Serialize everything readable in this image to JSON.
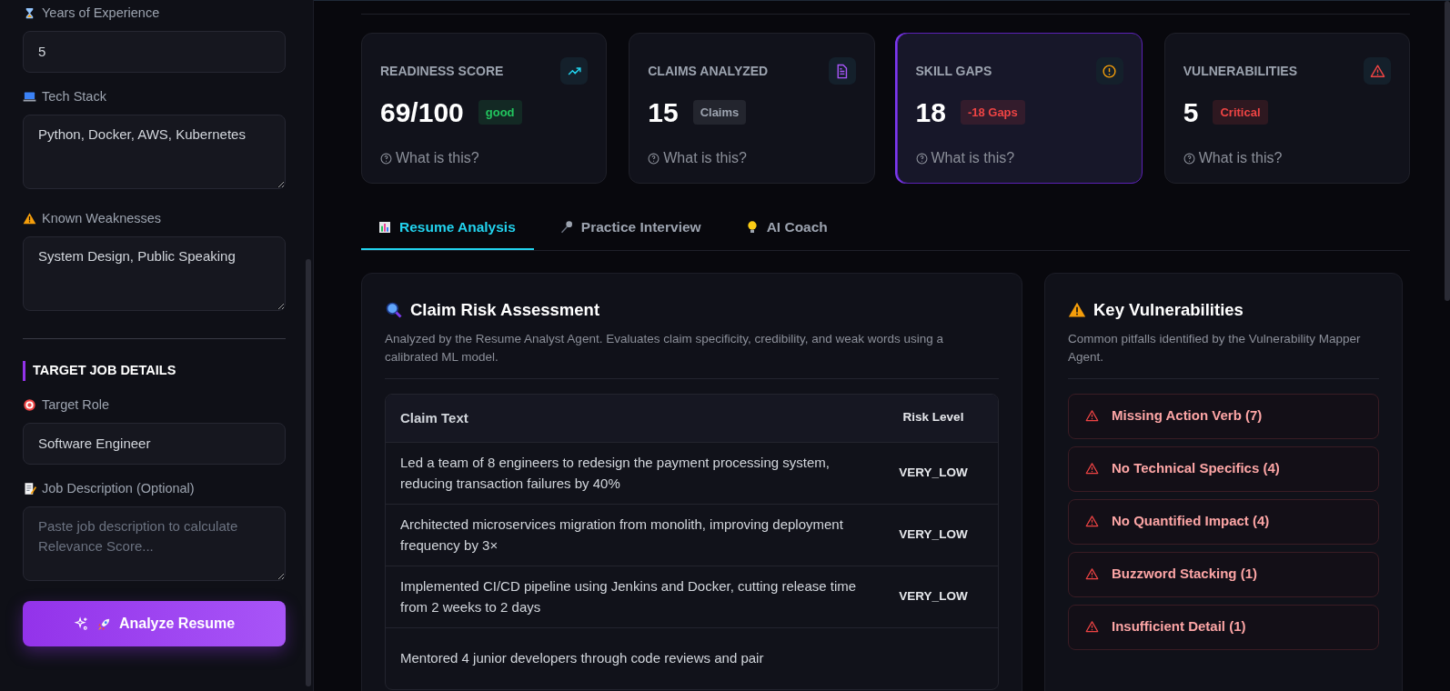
{
  "sidebar": {
    "fields_top": [
      {
        "label": "Years of Experience",
        "kind": "input",
        "value": "5"
      },
      {
        "label": "Tech Stack",
        "kind": "textarea",
        "value": "Python, Docker, AWS, Kubernetes"
      },
      {
        "label": "Known Weaknesses",
        "kind": "textarea",
        "value": "System Design, Public Speaking"
      }
    ],
    "section_title": "TARGET JOB DETAILS",
    "fields_bottom": [
      {
        "label": "Target Role",
        "kind": "input",
        "value": "Software Engineer"
      },
      {
        "label": "Job Description (Optional)",
        "kind": "textarea",
        "placeholder": "Paste job description to calculate Relevance Score..."
      }
    ],
    "action_button": "Analyze Resume"
  },
  "stats": [
    {
      "kind": "trend",
      "title": "READINESS SCORE",
      "value": "69/100",
      "badge": "good",
      "color": "#22c55e",
      "help": "What is this?",
      "highlighted": false
    },
    {
      "kind": "document",
      "title": "CLAIMS ANALYZED",
      "value": "15",
      "badge": "Claims",
      "color": "#9ca3af",
      "help": "What is this?",
      "highlighted": false
    },
    {
      "kind": "alert",
      "title": "SKILL GAPS",
      "value": "18",
      "badge": "-18 Gaps",
      "color": "#ef4444",
      "help": "What is this?",
      "highlighted": true
    },
    {
      "kind": "warning",
      "title": "VULNERABILITIES",
      "value": "5",
      "badge": "Critical",
      "color": "#ef4444",
      "help": "What is this?",
      "highlighted": false
    }
  ],
  "tabs": [
    {
      "label": "Resume Analysis",
      "selected": true
    },
    {
      "label": "Practice Interview",
      "selected": false
    },
    {
      "label": "AI Coach",
      "selected": false
    }
  ],
  "claims_panel": {
    "title": "Claim Risk Assessment",
    "description": "Analyzed by the Resume Analyst Agent. Evaluates claim specificity, credibility, and weak words using a calibrated ML model.",
    "table": {
      "columns": [
        "Claim Text",
        "Risk Level"
      ],
      "rows": [
        [
          "Led a team of 8 engineers to redesign the payment processing system, reducing transaction failures by 40%",
          "VERY_LOW"
        ],
        [
          "Architected microservices migration from monolith, improving deployment frequency by 3×",
          "VERY_LOW"
        ],
        [
          "Implemented CI/CD pipeline using Jenkins and Docker, cutting release time from 2 weeks to 2 days",
          "VERY_LOW"
        ],
        [
          "Mentored 4 junior developers through code reviews and pair",
          ""
        ]
      ]
    }
  },
  "vulnerabilities_panel": {
    "title": "Key Vulnerabilities",
    "description": "Common pitfalls identified by the Vulnerability Mapper Agent.",
    "items": [
      "Missing Action Verb (7)",
      "No Technical Specifics (4)",
      "No Quantified Impact (4)",
      "Buzzword Stacking (1)",
      "Insufficient Detail (1)"
    ]
  }
}
